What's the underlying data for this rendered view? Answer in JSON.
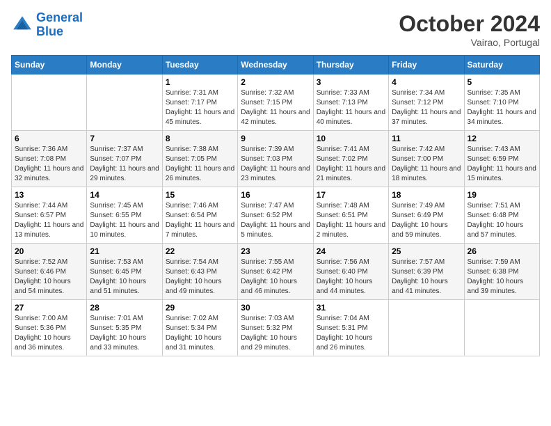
{
  "header": {
    "logo_line1": "General",
    "logo_line2": "Blue",
    "month": "October 2024",
    "location": "Vairao, Portugal"
  },
  "weekdays": [
    "Sunday",
    "Monday",
    "Tuesday",
    "Wednesday",
    "Thursday",
    "Friday",
    "Saturday"
  ],
  "weeks": [
    [
      {
        "day": "",
        "sunrise": "",
        "sunset": "",
        "daylight": ""
      },
      {
        "day": "",
        "sunrise": "",
        "sunset": "",
        "daylight": ""
      },
      {
        "day": "1",
        "sunrise": "Sunrise: 7:31 AM",
        "sunset": "Sunset: 7:17 PM",
        "daylight": "Daylight: 11 hours and 45 minutes."
      },
      {
        "day": "2",
        "sunrise": "Sunrise: 7:32 AM",
        "sunset": "Sunset: 7:15 PM",
        "daylight": "Daylight: 11 hours and 42 minutes."
      },
      {
        "day": "3",
        "sunrise": "Sunrise: 7:33 AM",
        "sunset": "Sunset: 7:13 PM",
        "daylight": "Daylight: 11 hours and 40 minutes."
      },
      {
        "day": "4",
        "sunrise": "Sunrise: 7:34 AM",
        "sunset": "Sunset: 7:12 PM",
        "daylight": "Daylight: 11 hours and 37 minutes."
      },
      {
        "day": "5",
        "sunrise": "Sunrise: 7:35 AM",
        "sunset": "Sunset: 7:10 PM",
        "daylight": "Daylight: 11 hours and 34 minutes."
      }
    ],
    [
      {
        "day": "6",
        "sunrise": "Sunrise: 7:36 AM",
        "sunset": "Sunset: 7:08 PM",
        "daylight": "Daylight: 11 hours and 32 minutes."
      },
      {
        "day": "7",
        "sunrise": "Sunrise: 7:37 AM",
        "sunset": "Sunset: 7:07 PM",
        "daylight": "Daylight: 11 hours and 29 minutes."
      },
      {
        "day": "8",
        "sunrise": "Sunrise: 7:38 AM",
        "sunset": "Sunset: 7:05 PM",
        "daylight": "Daylight: 11 hours and 26 minutes."
      },
      {
        "day": "9",
        "sunrise": "Sunrise: 7:39 AM",
        "sunset": "Sunset: 7:03 PM",
        "daylight": "Daylight: 11 hours and 23 minutes."
      },
      {
        "day": "10",
        "sunrise": "Sunrise: 7:41 AM",
        "sunset": "Sunset: 7:02 PM",
        "daylight": "Daylight: 11 hours and 21 minutes."
      },
      {
        "day": "11",
        "sunrise": "Sunrise: 7:42 AM",
        "sunset": "Sunset: 7:00 PM",
        "daylight": "Daylight: 11 hours and 18 minutes."
      },
      {
        "day": "12",
        "sunrise": "Sunrise: 7:43 AM",
        "sunset": "Sunset: 6:59 PM",
        "daylight": "Daylight: 11 hours and 15 minutes."
      }
    ],
    [
      {
        "day": "13",
        "sunrise": "Sunrise: 7:44 AM",
        "sunset": "Sunset: 6:57 PM",
        "daylight": "Daylight: 11 hours and 13 minutes."
      },
      {
        "day": "14",
        "sunrise": "Sunrise: 7:45 AM",
        "sunset": "Sunset: 6:55 PM",
        "daylight": "Daylight: 11 hours and 10 minutes."
      },
      {
        "day": "15",
        "sunrise": "Sunrise: 7:46 AM",
        "sunset": "Sunset: 6:54 PM",
        "daylight": "Daylight: 11 hours and 7 minutes."
      },
      {
        "day": "16",
        "sunrise": "Sunrise: 7:47 AM",
        "sunset": "Sunset: 6:52 PM",
        "daylight": "Daylight: 11 hours and 5 minutes."
      },
      {
        "day": "17",
        "sunrise": "Sunrise: 7:48 AM",
        "sunset": "Sunset: 6:51 PM",
        "daylight": "Daylight: 11 hours and 2 minutes."
      },
      {
        "day": "18",
        "sunrise": "Sunrise: 7:49 AM",
        "sunset": "Sunset: 6:49 PM",
        "daylight": "Daylight: 10 hours and 59 minutes."
      },
      {
        "day": "19",
        "sunrise": "Sunrise: 7:51 AM",
        "sunset": "Sunset: 6:48 PM",
        "daylight": "Daylight: 10 hours and 57 minutes."
      }
    ],
    [
      {
        "day": "20",
        "sunrise": "Sunrise: 7:52 AM",
        "sunset": "Sunset: 6:46 PM",
        "daylight": "Daylight: 10 hours and 54 minutes."
      },
      {
        "day": "21",
        "sunrise": "Sunrise: 7:53 AM",
        "sunset": "Sunset: 6:45 PM",
        "daylight": "Daylight: 10 hours and 51 minutes."
      },
      {
        "day": "22",
        "sunrise": "Sunrise: 7:54 AM",
        "sunset": "Sunset: 6:43 PM",
        "daylight": "Daylight: 10 hours and 49 minutes."
      },
      {
        "day": "23",
        "sunrise": "Sunrise: 7:55 AM",
        "sunset": "Sunset: 6:42 PM",
        "daylight": "Daylight: 10 hours and 46 minutes."
      },
      {
        "day": "24",
        "sunrise": "Sunrise: 7:56 AM",
        "sunset": "Sunset: 6:40 PM",
        "daylight": "Daylight: 10 hours and 44 minutes."
      },
      {
        "day": "25",
        "sunrise": "Sunrise: 7:57 AM",
        "sunset": "Sunset: 6:39 PM",
        "daylight": "Daylight: 10 hours and 41 minutes."
      },
      {
        "day": "26",
        "sunrise": "Sunrise: 7:59 AM",
        "sunset": "Sunset: 6:38 PM",
        "daylight": "Daylight: 10 hours and 39 minutes."
      }
    ],
    [
      {
        "day": "27",
        "sunrise": "Sunrise: 7:00 AM",
        "sunset": "Sunset: 5:36 PM",
        "daylight": "Daylight: 10 hours and 36 minutes."
      },
      {
        "day": "28",
        "sunrise": "Sunrise: 7:01 AM",
        "sunset": "Sunset: 5:35 PM",
        "daylight": "Daylight: 10 hours and 33 minutes."
      },
      {
        "day": "29",
        "sunrise": "Sunrise: 7:02 AM",
        "sunset": "Sunset: 5:34 PM",
        "daylight": "Daylight: 10 hours and 31 minutes."
      },
      {
        "day": "30",
        "sunrise": "Sunrise: 7:03 AM",
        "sunset": "Sunset: 5:32 PM",
        "daylight": "Daylight: 10 hours and 29 minutes."
      },
      {
        "day": "31",
        "sunrise": "Sunrise: 7:04 AM",
        "sunset": "Sunset: 5:31 PM",
        "daylight": "Daylight: 10 hours and 26 minutes."
      },
      {
        "day": "",
        "sunrise": "",
        "sunset": "",
        "daylight": ""
      },
      {
        "day": "",
        "sunrise": "",
        "sunset": "",
        "daylight": ""
      }
    ]
  ]
}
